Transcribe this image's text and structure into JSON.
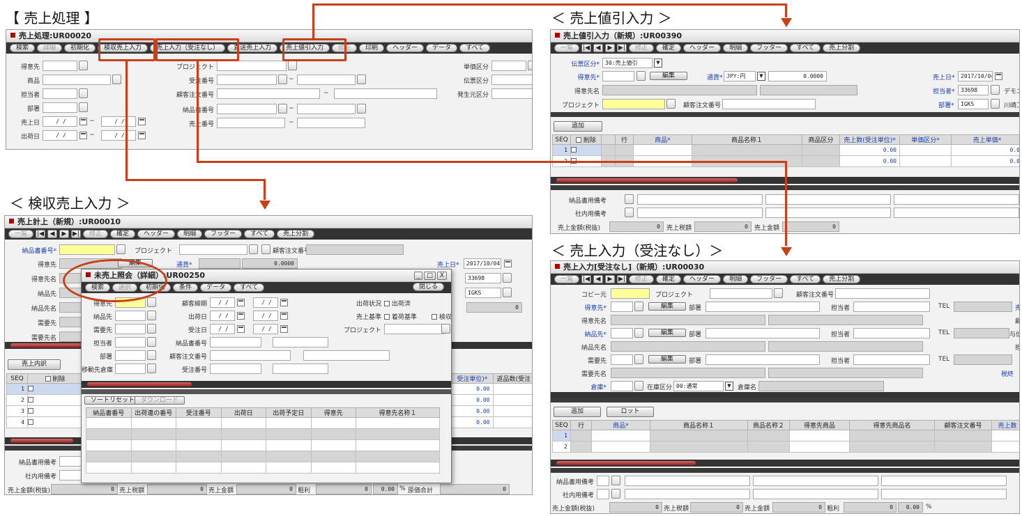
{
  "sections": {
    "sales": "【 売上処理 】",
    "inspect": "＜ 検収売上入力 ＞",
    "discount": "＜ 売上値引入力 ＞",
    "noorder": "＜ 売上入力（受注なし）＞"
  },
  "w1": {
    "title": "売上処理:UR00020",
    "tb": [
      "検索",
      "詳細",
      "初期化",
      "検収売上入力",
      "売上入力（受注なし）",
      "直送売上入力",
      "売上値引入力",
      "修正",
      "印刷",
      "ヘッダー",
      "データ",
      "すべて"
    ],
    "l": [
      "得意先",
      "商品",
      "担当者",
      "部署",
      "売上日",
      "出荷日"
    ],
    "m": [
      "プロジェクト",
      "受注番号",
      "顧客注文番号",
      "納品書番号",
      "売上番号"
    ],
    "r": [
      "単価区分",
      "伝票区分",
      "発生元区分"
    ],
    "date": "/ /",
    "tilde": "~"
  },
  "w2": {
    "title": "売上計上（新規）:UR00010",
    "tb": [
      "一覧",
      "|◀",
      "◀",
      "▶",
      "▶|",
      "修正",
      "確定",
      "ヘッダー",
      "明細",
      "フッター",
      "すべて",
      "売上分割"
    ],
    "l": [
      "納品書番号*",
      "得意先",
      "得意先名",
      "納品先",
      "納品先名",
      "需要先",
      "需要先名"
    ],
    "proj": "プロジェクト",
    "cust_no": "顧客注文番号",
    "edit": "編集",
    "curr": "通貨*",
    "amt": "0.0000",
    "date_lbl": "売上日*",
    "date_val": "2017/10/04",
    "tanto_val": "33698",
    "bumon_val": "IGKS",
    "zero": "0",
    "detail_btn": "売上内訳",
    "cols": [
      "SEQ",
      "削除"
    ],
    "rows": [
      "1",
      "2",
      "3",
      "4"
    ],
    "right_cols": [
      "受注単位)*",
      "返品数(受注"
    ],
    "vals": [
      "0.00",
      "0.00",
      "0.00",
      "0.00"
    ],
    "foot_l": [
      "納品書用備考",
      "社内用備考"
    ],
    "foot": [
      "売上金額(税抜)",
      "0",
      "売上税額",
      "0",
      "売上金額",
      "0",
      "粗利",
      "0",
      "0.00",
      "%",
      "原価合計",
      "0"
    ]
  },
  "w3": {
    "title": "未売上照会（詳細）:UR00250",
    "ctrl": [
      "_",
      "□",
      "X"
    ],
    "close": "閉じる",
    "tb": [
      "検索",
      "選択",
      "初期化",
      "条件",
      "データ",
      "すべて"
    ],
    "l": [
      "得意先",
      "納品先",
      "需要先",
      "担当者",
      "部署",
      "移動先倉庫"
    ],
    "m": [
      "顧客締期",
      "出荷日",
      "受注日",
      "納品書番号",
      "顧客注文番号",
      "受注番号"
    ],
    "r": [
      "出荷状況",
      "売上基準",
      "プロジェクト"
    ],
    "chk": [
      "出荷済",
      "着荷基準",
      "検収"
    ],
    "btns": [
      "ソートリセット",
      "ダウンロード"
    ],
    "cols": [
      "納品書番号",
      "出荷連の番号",
      "受注番号",
      "出荷日",
      "出荷予定日",
      "得意先",
      "得意先名称１"
    ]
  },
  "w4": {
    "title": "売上値引入力（新規）:UR00390",
    "tb": [
      "一覧",
      "|◀",
      "◀",
      "▶",
      "▶|",
      "修正",
      "確定",
      "ヘッダー",
      "明細",
      "フッター",
      "すべて",
      "売上分割"
    ],
    "denpyo_lbl": "伝票区分*",
    "denpyo_val": "30:売上値引",
    "tokui_lbl": "得意先*",
    "edit": "編集",
    "curr_lbl": "通貨*",
    "curr_val": "JPY:円",
    "amt": "0.0000",
    "name_lbl": "得意先名",
    "proj_lbl": "プロジェクト",
    "cust_lbl": "顧客注文番号",
    "date_lbl": "売上日*",
    "date_val": "2017/10/04",
    "tanto_lbl": "担当者*",
    "tanto_val": "33698",
    "tanto_name": "デモユ",
    "bumon_lbl": "部署*",
    "bumon_val": "IGKS",
    "bumon_name": "川崎工",
    "add": "追加",
    "cols": [
      "SEQ",
      "削除",
      "行",
      "商品*",
      "商品名称１",
      "商品区分",
      "売上数(受注単位)*",
      "単価区分*",
      "売上単価*"
    ],
    "rows": [
      "1",
      "2",
      "3"
    ],
    "vals": [
      "0.00",
      "0.00",
      "0.00"
    ],
    "cut": "0.0",
    "foot_l": [
      "納品書用備考",
      "社内用備考"
    ],
    "foot": [
      "売上金額(税抜)",
      "0",
      "売上税額",
      "0",
      "売上金額",
      "0"
    ]
  },
  "w5": {
    "title": "売上入力[受注なし]（新規）:UR00030",
    "tb": [
      "一覧",
      "|◀",
      "◀",
      "▶",
      "▶|",
      "修正",
      "確定",
      "ヘッダー",
      "明細",
      "フッター",
      "すべて",
      "売上分割"
    ],
    "l": [
      "コピー元",
      "得意先*",
      "得意先名",
      "納品先*",
      "納品先名",
      "需要先",
      "需要先名",
      "倉庫*"
    ],
    "proj": "プロジェクト",
    "cust": "顧客注文番号",
    "edit": "編集",
    "bumon": "部署",
    "tanto": "担当者",
    "tel": "TEL",
    "zaiko_lbl": "在庫区分",
    "zaiko_val": "00:通常",
    "souko_name": "倉庫名",
    "right": [
      "売",
      "顧",
      "与信",
      "担",
      "税終"
    ],
    "add": "追加",
    "lot": "ロット",
    "cols": [
      "SEQ",
      "行",
      "商品*",
      "商品名称１",
      "商品名称２",
      "得意先商品",
      "得意先商品名",
      "顧客注文番号",
      "売上数"
    ],
    "rows": [
      "1",
      "2"
    ],
    "foot_l": [
      "納品書用備考",
      "社内用備考"
    ],
    "foot": [
      "売上金額(税抜)",
      "0",
      "売上税額",
      "0",
      "売上金額",
      "0",
      "粗利",
      "0",
      "0.00",
      "%"
    ]
  }
}
